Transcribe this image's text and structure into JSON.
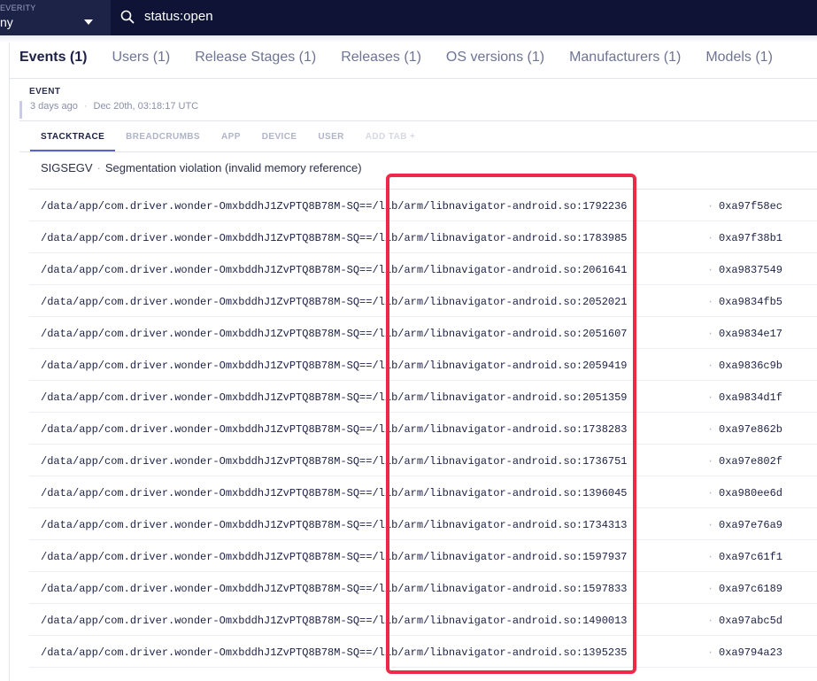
{
  "topbar": {
    "severity_label": "EVERITY",
    "severity_value": "ny",
    "search_value": "status:open"
  },
  "tabs": [
    {
      "label": "Events (1)"
    },
    {
      "label": "Users (1)"
    },
    {
      "label": "Release Stages (1)"
    },
    {
      "label": "Releases (1)"
    },
    {
      "label": "OS versions (1)"
    },
    {
      "label": "Manufacturers (1)"
    },
    {
      "label": "Models (1)"
    }
  ],
  "event": {
    "label": "EVENT",
    "relative_time": "3 days ago",
    "timestamp": "Dec 20th, 03:18:17 UTC"
  },
  "subtabs": [
    {
      "label": "STACKTRACE"
    },
    {
      "label": "BREADCRUMBS"
    },
    {
      "label": "APP"
    },
    {
      "label": "DEVICE"
    },
    {
      "label": "USER"
    },
    {
      "label": "ADD TAB +"
    }
  ],
  "error": {
    "signal": "SIGSEGV",
    "message": "Segmentation violation (invalid memory reference)"
  },
  "frames": [
    {
      "path": "/data/app/com.driver.wonder-OmxbddhJ1ZvPTQ8B78M-SQ==/lib/arm/libnavigator-android.so:1792236",
      "address": "0xa97f58ec"
    },
    {
      "path": "/data/app/com.driver.wonder-OmxbddhJ1ZvPTQ8B78M-SQ==/lib/arm/libnavigator-android.so:1783985",
      "address": "0xa97f38b1"
    },
    {
      "path": "/data/app/com.driver.wonder-OmxbddhJ1ZvPTQ8B78M-SQ==/lib/arm/libnavigator-android.so:2061641",
      "address": "0xa9837549"
    },
    {
      "path": "/data/app/com.driver.wonder-OmxbddhJ1ZvPTQ8B78M-SQ==/lib/arm/libnavigator-android.so:2052021",
      "address": "0xa9834fb5"
    },
    {
      "path": "/data/app/com.driver.wonder-OmxbddhJ1ZvPTQ8B78M-SQ==/lib/arm/libnavigator-android.so:2051607",
      "address": "0xa9834e17"
    },
    {
      "path": "/data/app/com.driver.wonder-OmxbddhJ1ZvPTQ8B78M-SQ==/lib/arm/libnavigator-android.so:2059419",
      "address": "0xa9836c9b"
    },
    {
      "path": "/data/app/com.driver.wonder-OmxbddhJ1ZvPTQ8B78M-SQ==/lib/arm/libnavigator-android.so:2051359",
      "address": "0xa9834d1f"
    },
    {
      "path": "/data/app/com.driver.wonder-OmxbddhJ1ZvPTQ8B78M-SQ==/lib/arm/libnavigator-android.so:1738283",
      "address": "0xa97e862b"
    },
    {
      "path": "/data/app/com.driver.wonder-OmxbddhJ1ZvPTQ8B78M-SQ==/lib/arm/libnavigator-android.so:1736751",
      "address": "0xa97e802f"
    },
    {
      "path": "/data/app/com.driver.wonder-OmxbddhJ1ZvPTQ8B78M-SQ==/lib/arm/libnavigator-android.so:1396045",
      "address": "0xa980ee6d"
    },
    {
      "path": "/data/app/com.driver.wonder-OmxbddhJ1ZvPTQ8B78M-SQ==/lib/arm/libnavigator-android.so:1734313",
      "address": "0xa97e76a9"
    },
    {
      "path": "/data/app/com.driver.wonder-OmxbddhJ1ZvPTQ8B78M-SQ==/lib/arm/libnavigator-android.so:1597937",
      "address": "0xa97c61f1"
    },
    {
      "path": "/data/app/com.driver.wonder-OmxbddhJ1ZvPTQ8B78M-SQ==/lib/arm/libnavigator-android.so:1597833",
      "address": "0xa97c6189"
    },
    {
      "path": "/data/app/com.driver.wonder-OmxbddhJ1ZvPTQ8B78M-SQ==/lib/arm/libnavigator-android.so:1490013",
      "address": "0xa97abc5d"
    },
    {
      "path": "/data/app/com.driver.wonder-OmxbddhJ1ZvPTQ8B78M-SQ==/lib/arm/libnavigator-android.so:1395235",
      "address": "0xa9794a23"
    }
  ],
  "colors": {
    "topbar_bg": "#0f1437",
    "accent": "#5a63c8",
    "highlight": "#ee2948"
  }
}
